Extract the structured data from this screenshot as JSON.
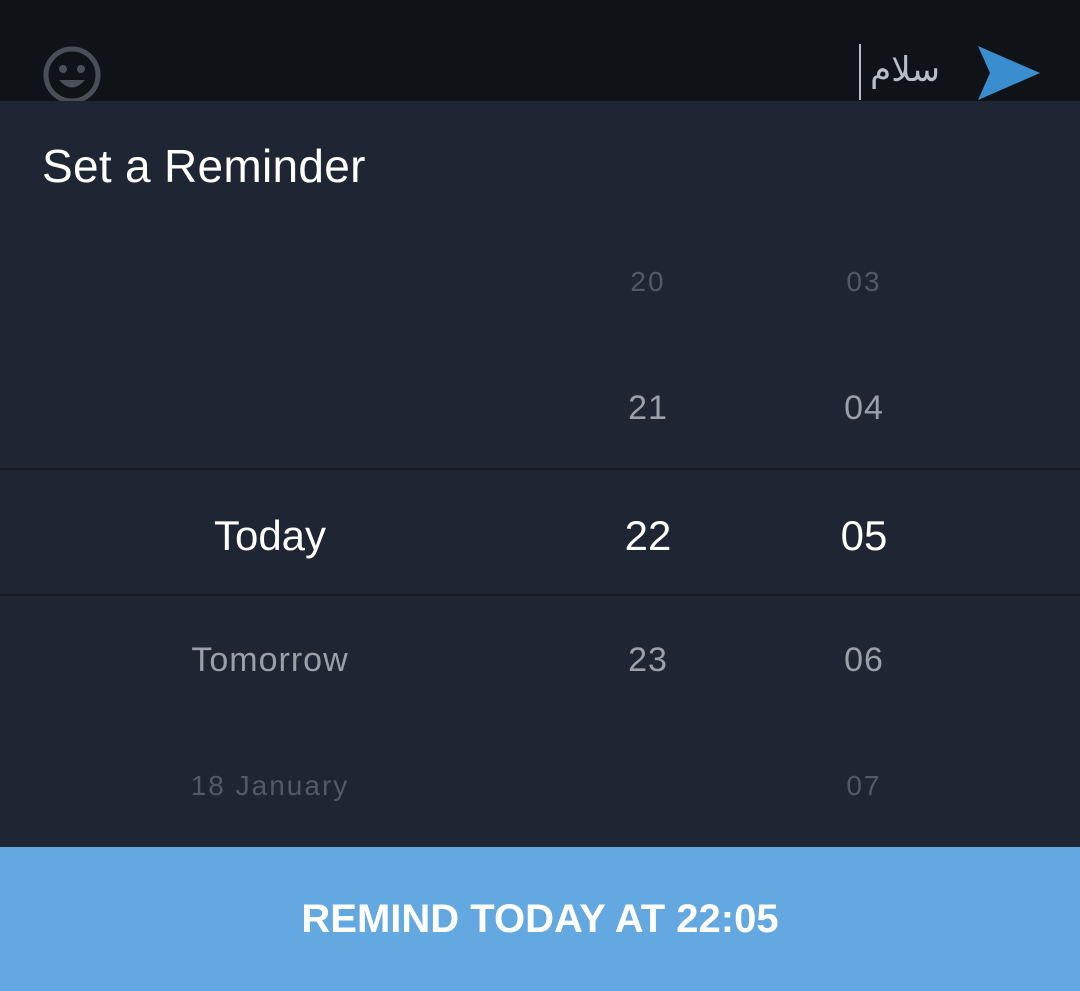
{
  "composer": {
    "message_text": "سلام",
    "emoji_icon": "smiley-face-icon",
    "send_icon": "send-arrow-icon",
    "send_color": "#3a8ed0"
  },
  "dialog": {
    "title": "Set a Reminder",
    "day_column": {
      "items": [
        "Today",
        "Tomorrow",
        "18 January"
      ],
      "selected": "Today"
    },
    "hour_column": {
      "items": [
        "20",
        "21",
        "22",
        "23"
      ],
      "selected": "22"
    },
    "minute_column": {
      "items": [
        "03",
        "04",
        "05",
        "06",
        "07"
      ],
      "selected": "05"
    },
    "confirm_label": "REMIND TODAY AT 22:05",
    "accent_color": "#63a8e0"
  }
}
